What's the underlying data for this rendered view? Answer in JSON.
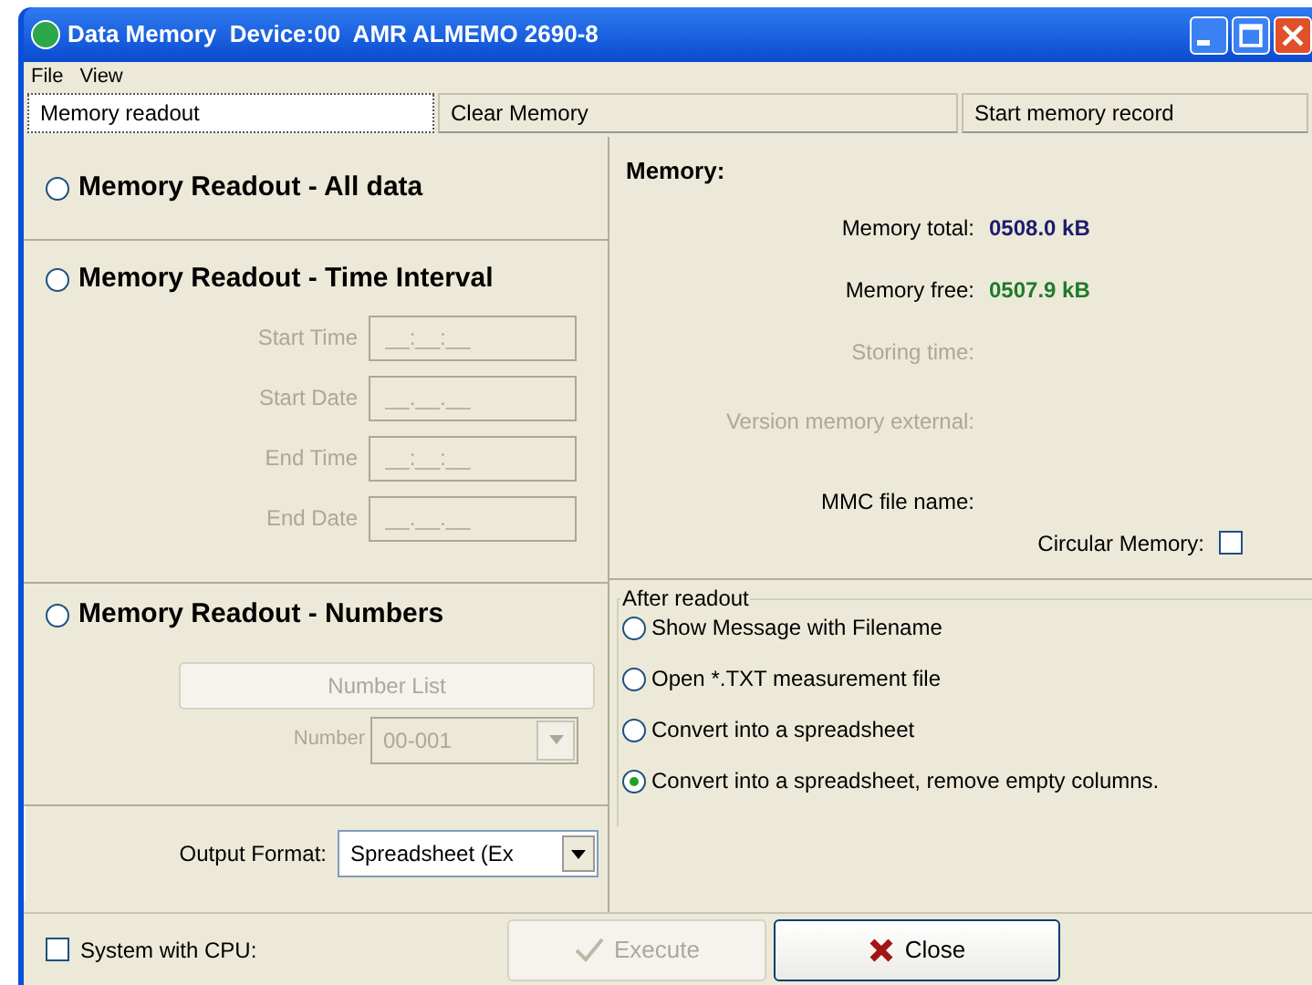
{
  "window": {
    "title": "Data Memory  Device:00  AMR ALMEMO 2690-8"
  },
  "menu": [
    "File",
    "View"
  ],
  "tabs": [
    {
      "label": "Memory readout",
      "selected": true
    },
    {
      "label": "Clear Memory",
      "selected": false
    },
    {
      "label": "Start memory record",
      "selected": false
    }
  ],
  "readout_modes": [
    {
      "label": "Memory Readout - All data",
      "selected": false
    },
    {
      "label": "Memory Readout - Time Interval",
      "selected": false,
      "fields": [
        {
          "label": "Start Time",
          "placeholder": "__:__:__",
          "disabled": true
        },
        {
          "label": "Start Date",
          "placeholder": "__.__.__",
          "disabled": true
        },
        {
          "label": "End Time",
          "placeholder": "__:__:__",
          "disabled": true
        },
        {
          "label": "End Date",
          "placeholder": "__.__.__",
          "disabled": true
        }
      ]
    },
    {
      "label": "Memory Readout - Numbers",
      "selected": false,
      "button": {
        "label": "Number List",
        "disabled": true
      },
      "number": {
        "label": "Number",
        "value": "00-001",
        "disabled": true
      }
    }
  ],
  "output_format": {
    "label": "Output Format:",
    "value": "Spreadsheet (Ex"
  },
  "memory": {
    "title": "Memory:",
    "rows": [
      {
        "label": "Memory total:",
        "value": "0508.0 kB",
        "color": "#1c1c6e",
        "disabled": false
      },
      {
        "label": "Memory free:",
        "value": "0507.9 kB",
        "color": "#1f7a2a",
        "disabled": false
      },
      {
        "label": "Storing time:",
        "disabled": true
      },
      {
        "label": "Version memory external:",
        "disabled": true
      },
      {
        "label": "MMC file name:",
        "disabled": false
      }
    ],
    "circular": {
      "label": "Circular Memory:",
      "checked": false
    }
  },
  "after_readout": {
    "title": "After readout",
    "options": [
      {
        "label": "Show Message with Filename",
        "selected": false
      },
      {
        "label": "Open *.TXT measurement file",
        "selected": false
      },
      {
        "label": "Convert into a spreadsheet",
        "selected": false
      },
      {
        "label": "Convert into a spreadsheet, remove empty columns.",
        "selected": true
      }
    ]
  },
  "system_cpu": {
    "label": "System with CPU:",
    "checked": false
  },
  "buttons": [
    {
      "kind": "execute",
      "label": "Execute",
      "disabled": true
    },
    {
      "kind": "close",
      "label": "Close",
      "disabled": false
    }
  ]
}
